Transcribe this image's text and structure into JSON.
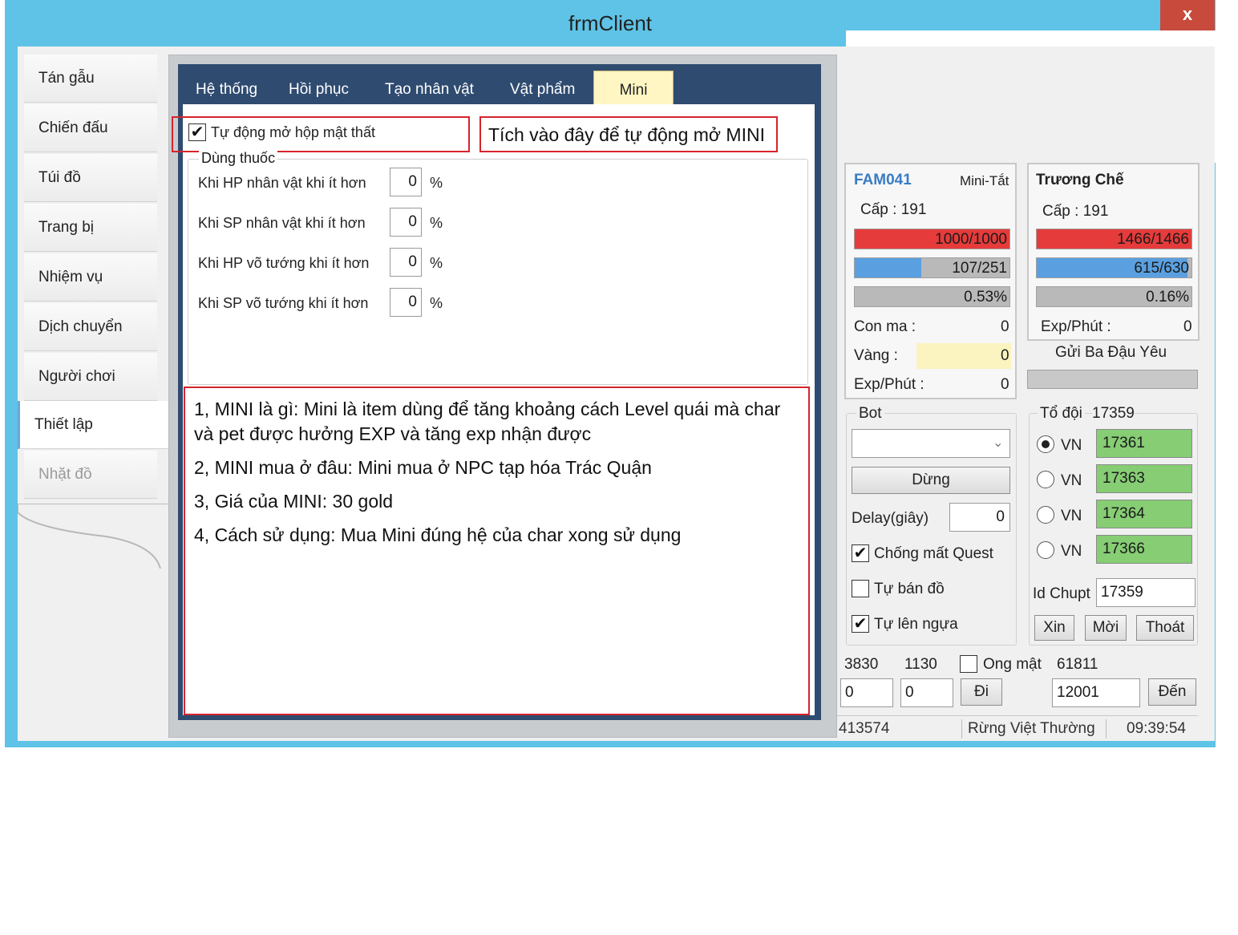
{
  "window": {
    "title": "frmClient",
    "close_label": "x"
  },
  "nav": {
    "items": [
      {
        "label": "Tán gẫu"
      },
      {
        "label": "Chiến đấu"
      },
      {
        "label": "Túi đồ"
      },
      {
        "label": "Trang bị"
      },
      {
        "label": "Nhiệm vụ"
      },
      {
        "label": "Dịch chuyển"
      },
      {
        "label": "Người chơi"
      },
      {
        "label": "Thiết lập"
      },
      {
        "label": "Nhặt đồ"
      }
    ],
    "active": "Thiết lập"
  },
  "tabs": {
    "items": [
      "Hệ thống",
      "Hồi phục",
      "Tạo nhân vật",
      "Vật phẩm",
      "Mini"
    ],
    "active": "Mini"
  },
  "mini": {
    "auto_open_label": "Tự động mở hộp mật thất",
    "auto_open_checked": true,
    "annotation": "Tích vào đây để tự động mở MINI",
    "potion_group_title": "Dùng thuốc",
    "potion_rows": [
      {
        "label": "Khi HP nhân vật khi ít hơn",
        "value": "0",
        "unit": "%"
      },
      {
        "label": "Khi SP nhân vật khi ít hơn",
        "value": "0",
        "unit": "%"
      },
      {
        "label": "Khi HP võ tướng khi ít hơn",
        "value": "0",
        "unit": "%"
      },
      {
        "label": "Khi SP võ tướng khi ít hơn",
        "value": "0",
        "unit": "%"
      }
    ],
    "info": [
      "1, MINI là gì: Mini là item dùng để tăng khoảng cách Level quái mà char",
      "và pet được hưởng EXP và tăng exp nhận được",
      "2, MINI mua ở đâu: Mini mua ở NPC tạp hóa Trác Quận",
      "3, Giá của MINI: 30 gold",
      "4, Cách sử dụng: Mua Mini đúng hệ của char xong sử dụng"
    ]
  },
  "char1": {
    "name": "FAM041",
    "tag": "Mini-Tắt",
    "level": "Cấp : 191",
    "hp_text": "1000/1000",
    "hp_fraction": 1.0,
    "sp_text": "107/251",
    "sp_fraction": 0.43,
    "exp_text": "0.53%",
    "exp_fraction": 0.0053,
    "con_ma_label": "Con ma :",
    "con_ma_value": "0",
    "vang_label": "Vàng :",
    "vang_value": "0",
    "exp_phut_label": "Exp/Phút :",
    "exp_phut_value": "0"
  },
  "char2": {
    "name": "Trương Chế",
    "level": "Cấp : 191",
    "hp_text": "1466/1466",
    "hp_fraction": 1.0,
    "sp_text": "615/630",
    "sp_fraction": 0.976,
    "exp_text": "0.16%",
    "exp_fraction": 0.0016,
    "exp_phut_label": "Exp/Phút :",
    "exp_phut_value": "0",
    "gift_label": "Gửi Ba Đậu Yêu"
  },
  "bot": {
    "title": "Bot",
    "select_value": "",
    "stop_label": "Dừng",
    "delay_label": "Delay(giây)",
    "delay_value": "0",
    "options": [
      {
        "label": "Chống mất Quest",
        "checked": true
      },
      {
        "label": "Tự bán đồ",
        "checked": false
      },
      {
        "label": "Tự lên ngựa",
        "checked": true
      }
    ]
  },
  "team": {
    "title": "Tổ đội",
    "id": "17359",
    "members": [
      {
        "label": "VN",
        "value": "17361",
        "selected": true
      },
      {
        "label": "VN",
        "value": "17363",
        "selected": false
      },
      {
        "label": "VN",
        "value": "17364",
        "selected": false
      },
      {
        "label": "VN",
        "value": "17366",
        "selected": false
      }
    ],
    "id_chupt_label": "Id Chupt",
    "id_chupt_value": "17359",
    "buttons": [
      "Xin",
      "Mời",
      "Thoát"
    ]
  },
  "coords": {
    "x": "3830",
    "y": "1130",
    "ong_mat_label": "Ong mật",
    "ong_mat_checked": false,
    "map_id": "61811",
    "input_x": "0",
    "input_y": "0",
    "go_label": "Đi",
    "dest_value": "12001",
    "den_label": "Đến"
  },
  "status": {
    "id": "413574",
    "location": "Rừng Việt Thường",
    "time": "09:39:54"
  },
  "colors": {
    "hp": "#e63b3b",
    "sp": "#5aa0e0",
    "exp": "#b9b9b9",
    "team_green": "#86cd74",
    "annotation_red": "#d6242c",
    "gold_hilite": "#fbf3c0"
  }
}
